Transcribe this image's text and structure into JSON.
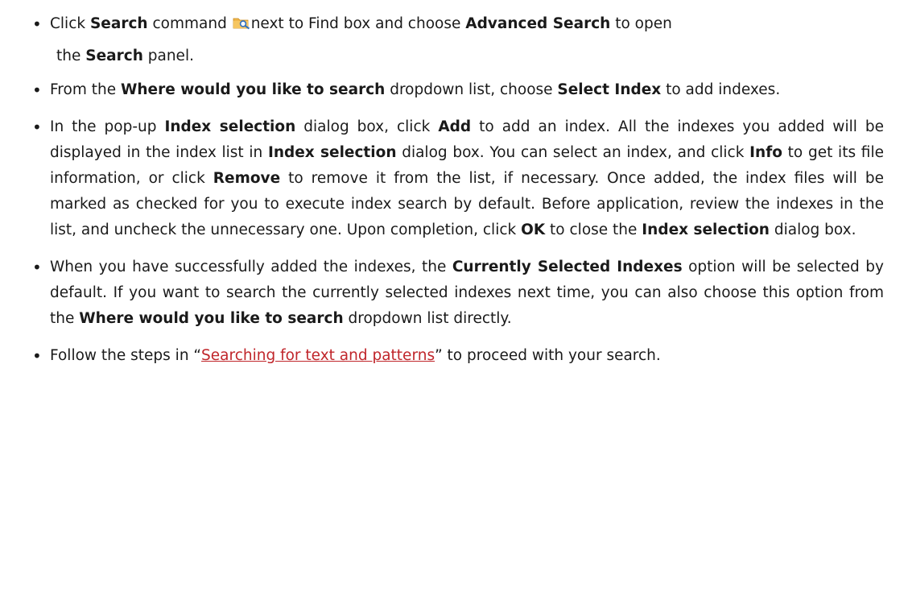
{
  "colors": {
    "text": "#1a1a1a",
    "link": "#c0262b",
    "icon_folder": "#f0b64a",
    "icon_magnifier": "#2e6fbf"
  },
  "icons": {
    "search_command": "search-folder-icon"
  },
  "bullets": [
    {
      "t1": "Click ",
      "b1": "Search",
      "t2": " command ",
      "t3": "next to Find box and choose ",
      "b2": "Advanced Search",
      "t4": " to open",
      "t5": "the ",
      "b3": "Search",
      "t6": " panel."
    },
    {
      "t1": "From the ",
      "b1": "Where would you like to search",
      "t2": " dropdown list, choose ",
      "b2": "Select Index",
      "t3": " to add indexes."
    },
    {
      "t1": "In the pop-up ",
      "b1": "Index selection",
      "t2": " dialog box, click ",
      "b2": "Add",
      "t3": " to add an index. All the indexes you added will be displayed in the index list in ",
      "b3": "Index selection",
      "t4": " dialog box. You can select an index, and click ",
      "b4": "Info",
      "t5": " to get its file information, or click ",
      "b5": "Remove",
      "t6": " to remove it from the list, if necessary. Once added, the index files will be marked as checked for you to execute index search by default. Before application, review the indexes in the list, and uncheck the unnecessary one. Upon completion, click ",
      "b6": "OK",
      "t7": " to close the ",
      "b7": "Index selection",
      "t8": " dialog box."
    },
    {
      "t1": "When you have successfully added the indexes, the ",
      "b1": "Currently Selected Indexes",
      "t2": " option will be selected by default. If you want to search the currently selected indexes next time, you can also choose this option from the ",
      "b2": "Where would you like to search",
      "t3": " dropdown list directly."
    },
    {
      "t1": "Follow the steps in “",
      "link": "Searching for text and patterns",
      "t2": "” to proceed with your search."
    }
  ]
}
